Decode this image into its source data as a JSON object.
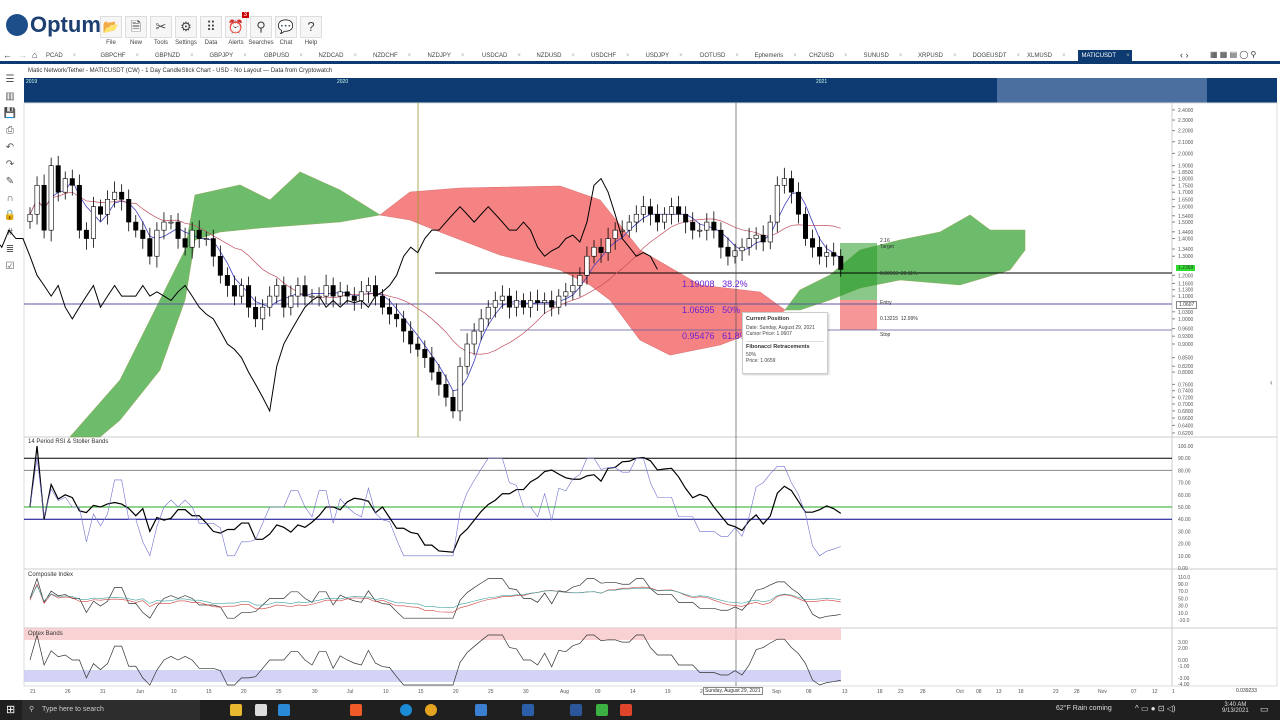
{
  "app": {
    "name": "Optuma"
  },
  "ribbon": [
    {
      "label": "File",
      "icon": "folder-icon",
      "glyph": "📂"
    },
    {
      "label": "New",
      "icon": "new-chart-icon",
      "glyph": "🗎"
    },
    {
      "label": "Tools",
      "icon": "tools-icon",
      "glyph": "✂"
    },
    {
      "label": "Settings",
      "icon": "settings-icon",
      "glyph": "⚙"
    },
    {
      "label": "Data",
      "icon": "data-icon",
      "glyph": "⠿"
    },
    {
      "label": "Alerts",
      "icon": "alarm-icon",
      "glyph": "⏰",
      "badge": "3"
    },
    {
      "label": "Searches",
      "icon": "search-icon",
      "glyph": "⚲"
    },
    {
      "label": "Chat",
      "icon": "chat-icon",
      "glyph": "💬"
    },
    {
      "label": "Help",
      "icon": "help-icon",
      "glyph": "?"
    }
  ],
  "tabs": [
    "PCAD",
    "GBPCHF",
    "GBPNZD",
    "GBPJPY",
    "GBPUSD",
    "NZDCAD",
    "NZDCHF",
    "NZDJPY",
    "USDCAD",
    "NZDUSD",
    "USDCHF",
    "USDJPY",
    "DOTUSD",
    "Ephemeris",
    "CHZUSD",
    "SUNUSD",
    "XRPUSD",
    "DOGEUSDT",
    "XLMUSD",
    "MATICUSDT"
  ],
  "active_tab": "MATICUSDT",
  "chart_title": "Matic Network/Tether - MATICUSDT (CW) - 1 Day CandleStick Chart - USD - No Layout — Data from Cryptowatch",
  "overview_years": [
    "2019",
    "2020",
    "2021"
  ],
  "price_axis": [
    "2.4000",
    "2.3000",
    "2.2000",
    "2.1000",
    "2.0000",
    "1.9000",
    "1.8500",
    "1.8000",
    "1.7500",
    "1.7000",
    "1.6500",
    "1.6000",
    "1.5400",
    "1.5000",
    "1.4400",
    "1.4000",
    "1.3400",
    "1.3000",
    "1.2000",
    "1.1600",
    "1.1300",
    "1.1000",
    "1.0300",
    "1.0000",
    "0.9600",
    "0.9300",
    "0.9000",
    "0.8500",
    "0.8200",
    "0.8000",
    "0.7600",
    "0.7400",
    "0.7200",
    "0.7000",
    "0.6800",
    "0.6600",
    "0.6400",
    "0.6200"
  ],
  "last_price": "1.2369",
  "cursor_price": "1.0607",
  "fib": [
    {
      "price": "1.19008",
      "pct": "38.2%"
    },
    {
      "price": "1.06595",
      "pct": "50%"
    },
    {
      "price": "0.95476",
      "pct": "61.8%"
    }
  ],
  "risk_reward": {
    "target_value": "2.16",
    "target": "Target",
    "reward": "0.20966",
    "reward_pct": "20.11%",
    "entry": "Entry",
    "risk": "0.13215",
    "risk_pct": "12.99%",
    "stop": "Stop"
  },
  "tooltip": {
    "title": "Current Position",
    "date": "Date: Sunday, August 29, 2021",
    "cursor": "Cursor Price: 1.0607",
    "section": "Fibonacci Retracements",
    "level": "50%",
    "price": "Price: 1.0659"
  },
  "panes": {
    "rsi": {
      "label": "14 Period RSI & Stoller Bands",
      "axis": [
        "100.00",
        "90.00",
        "80.00",
        "70.00",
        "60.00",
        "50.00",
        "40.00",
        "30.00",
        "20.00",
        "10.00",
        "0.00"
      ]
    },
    "composite": {
      "label": "Composite Index",
      "axis": [
        "110.0",
        "90.0",
        "70.0",
        "50.0",
        "30.0",
        "10.0",
        "-10.0"
      ]
    },
    "optex": {
      "label": "Optex Bands",
      "axis": [
        "3.00",
        "2.00",
        "0.00",
        "-1.00",
        "-3.00",
        "-4.00"
      ]
    }
  },
  "date_axis": [
    "21",
    "26",
    "31",
    "Jun",
    "10",
    "15",
    "20",
    "25",
    "30",
    "Jul",
    "10",
    "15",
    "20",
    "25",
    "30",
    "Aug",
    "09",
    "14",
    "19",
    "24",
    "Sep",
    "08",
    "13",
    "18",
    "23",
    "28",
    "Oct",
    "08",
    "13",
    "18",
    "23",
    "28",
    "Nov",
    "07",
    "12",
    "1"
  ],
  "cursor_date": "Sunday, August 29, 2021",
  "corner_value": "0.039233",
  "chart_data": {
    "type": "candlestick",
    "start": "2021-05-21",
    "closes": [
      1.55,
      1.75,
      1.45,
      1.9,
      1.7,
      1.8,
      1.75,
      1.45,
      1.4,
      1.6,
      1.55,
      1.65,
      1.7,
      1.65,
      1.5,
      1.45,
      1.4,
      1.3,
      1.45,
      1.5,
      1.5,
      1.4,
      1.35,
      1.45,
      1.4,
      1.4,
      1.3,
      1.2,
      1.15,
      1.1,
      1.15,
      1.05,
      1.0,
      1.05,
      1.1,
      1.15,
      1.05,
      1.1,
      1.15,
      1.1,
      1.1,
      1.1,
      1.15,
      1.1,
      1.12,
      1.1,
      1.08,
      1.12,
      1.15,
      1.1,
      1.05,
      1.02,
      1.0,
      0.95,
      0.9,
      0.88,
      0.85,
      0.8,
      0.76,
      0.72,
      0.68,
      0.82,
      0.9,
      0.95,
      1.0,
      1.05,
      1.08,
      1.1,
      1.05,
      1.08,
      1.05,
      1.08,
      1.07,
      1.08,
      1.05,
      1.1,
      1.12,
      1.15,
      1.2,
      1.3,
      1.35,
      1.32,
      1.4,
      1.45,
      1.45,
      1.5,
      1.55,
      1.6,
      1.55,
      1.5,
      1.55,
      1.6,
      1.55,
      1.5,
      1.45,
      1.45,
      1.5,
      1.45,
      1.35,
      1.3,
      1.33,
      1.35,
      1.4,
      1.42,
      1.38,
      1.5,
      1.75,
      1.8,
      1.7,
      1.55,
      1.4,
      1.35,
      1.3,
      1.32,
      1.3,
      1.23
    ]
  },
  "taskbar": {
    "search": "Type here to search",
    "weather": "62°F  Rain coming",
    "time": "3:40 AM",
    "date": "9/13/2021"
  }
}
